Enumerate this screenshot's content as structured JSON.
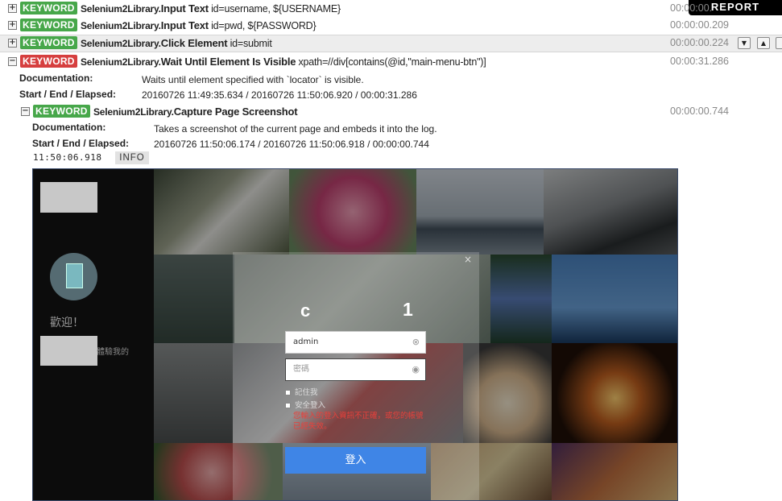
{
  "header": {
    "report_label": "REPORT"
  },
  "keywords": [
    {
      "label": "KEYWORD",
      "library": "Selenium2Library",
      "name": "Input Text",
      "args": "id=username, ${USERNAME}",
      "elapsed": "00:00:00. ",
      "toggle": "+"
    },
    {
      "label": "KEYWORD",
      "library": "Selenium2Library",
      "name": "Input Text",
      "args": "id=pwd, ${PASSWORD}",
      "elapsed": "00:00:00.209",
      "toggle": "+"
    },
    {
      "label": "KEYWORD",
      "library": "Selenium2Library",
      "name": "Click Element",
      "args": "id=submit",
      "elapsed": "00:00:00.224",
      "toggle": "+"
    },
    {
      "label": "KEYWORD",
      "library": "Selenium2Library",
      "name": "Wait Until Element Is Visible",
      "args": "xpath=//div[contains(@id,\"main-menu-btn\")]",
      "elapsed": "00:00:31.286",
      "toggle": "−"
    }
  ],
  "wait_details": {
    "doc_label": "Documentation:",
    "doc_value": "Waits until element specified with `locator` is visible.",
    "time_label": "Start / End / Elapsed:",
    "time_value": "20160726 11:49:35.634 / 20160726 11:50:06.920 / 00:00:31.286"
  },
  "screenshot_kw": {
    "label": "KEYWORD",
    "library": "Selenium2Library",
    "name": "Capture Page Screenshot",
    "elapsed": "00:00:00.744",
    "toggle": "−",
    "doc_label": "Documentation:",
    "doc_value": "Takes a screenshot of the current page and embeds it into the log.",
    "time_label": "Start / End / Elapsed:",
    "time_value": "20160726 11:50:06.174 / 20160726 11:50:06.918 / 00:00:00.744"
  },
  "message": {
    "timestamp": "11:50:06.918",
    "level": "INFO"
  },
  "embedded_page": {
    "welcome": "歡迎！",
    "side_text": "體驗我的",
    "close_icon": "×",
    "logo_left": "c",
    "logo_right": "1",
    "username_value": "admin",
    "password_placeholder": "密碼",
    "remember_label": "記住我",
    "secure_label": "安全登入",
    "error_text": "您輸入的登入資訊不正確，或您的帳號已經失效。",
    "login_button": "登入"
  },
  "colors": {
    "keyword_pass": "#47a74a",
    "keyword_fail": "#d63f3f",
    "login_button": "#3f85e6",
    "error": "#e8403b"
  }
}
